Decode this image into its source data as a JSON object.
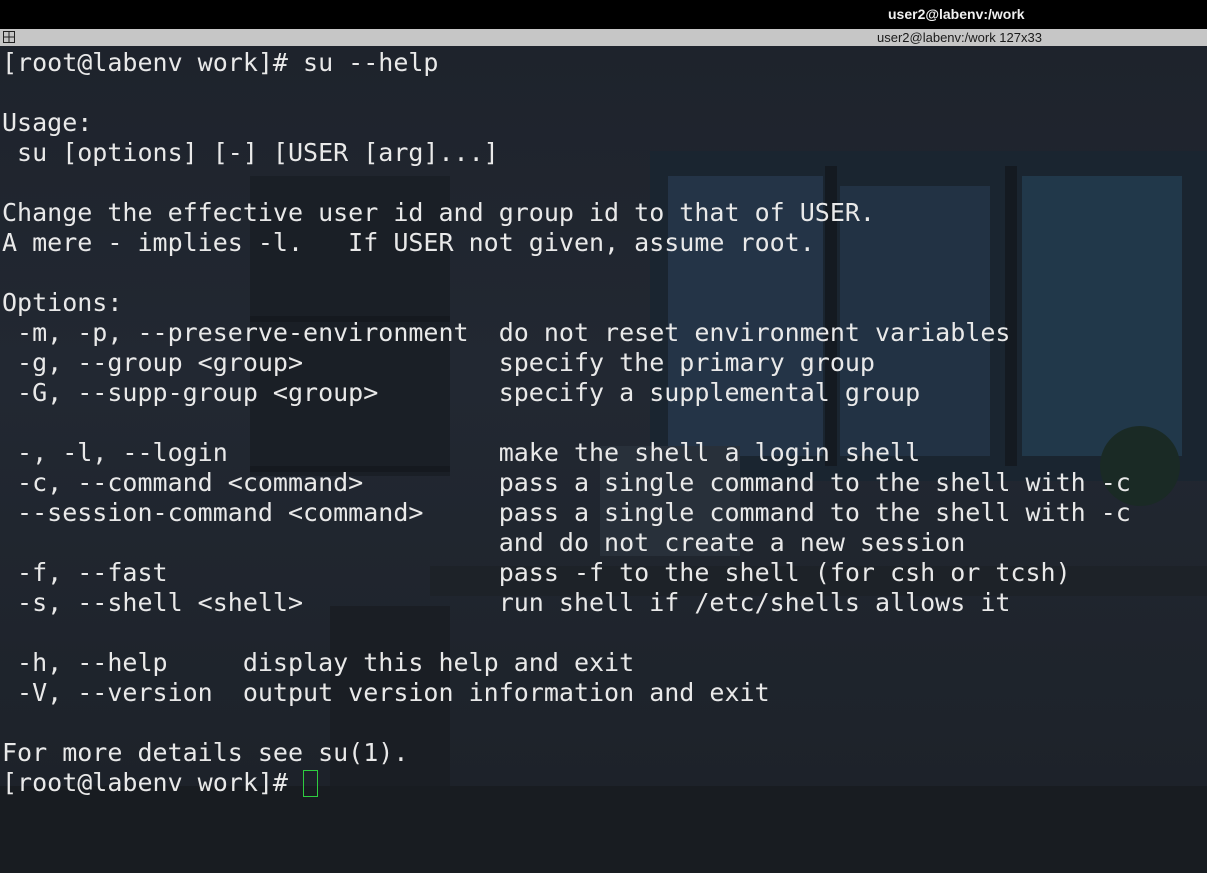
{
  "window": {
    "title": "user2@labenv:/work",
    "info": "user2@labenv:/work 127x33"
  },
  "terminal": {
    "lines": [
      "[root@labenv work]# su --help",
      "",
      "Usage:",
      " su [options] [-] [USER [arg]...]",
      "",
      "Change the effective user id and group id to that of USER.",
      "A mere - implies -l.   If USER not given, assume root.",
      "",
      "Options:",
      " -m, -p, --preserve-environment  do not reset environment variables",
      " -g, --group <group>             specify the primary group",
      " -G, --supp-group <group>        specify a supplemental group",
      "",
      " -, -l, --login                  make the shell a login shell",
      " -c, --command <command>         pass a single command to the shell with -c",
      " --session-command <command>     pass a single command to the shell with -c",
      "                                 and do not create a new session",
      " -f, --fast                      pass -f to the shell (for csh or tcsh)",
      " -s, --shell <shell>             run shell if /etc/shells allows it",
      "",
      " -h, --help     display this help and exit",
      " -V, --version  output version information and exit",
      "",
      "For more details see su(1)."
    ],
    "prompt": "[root@labenv work]# "
  },
  "colors": {
    "text": "#e9e9e9",
    "cursor": "#2ecc40",
    "titlebar": "#000000",
    "infobar": "#c6c6c6"
  },
  "icons": {
    "layout": "grid-layout-icon"
  }
}
